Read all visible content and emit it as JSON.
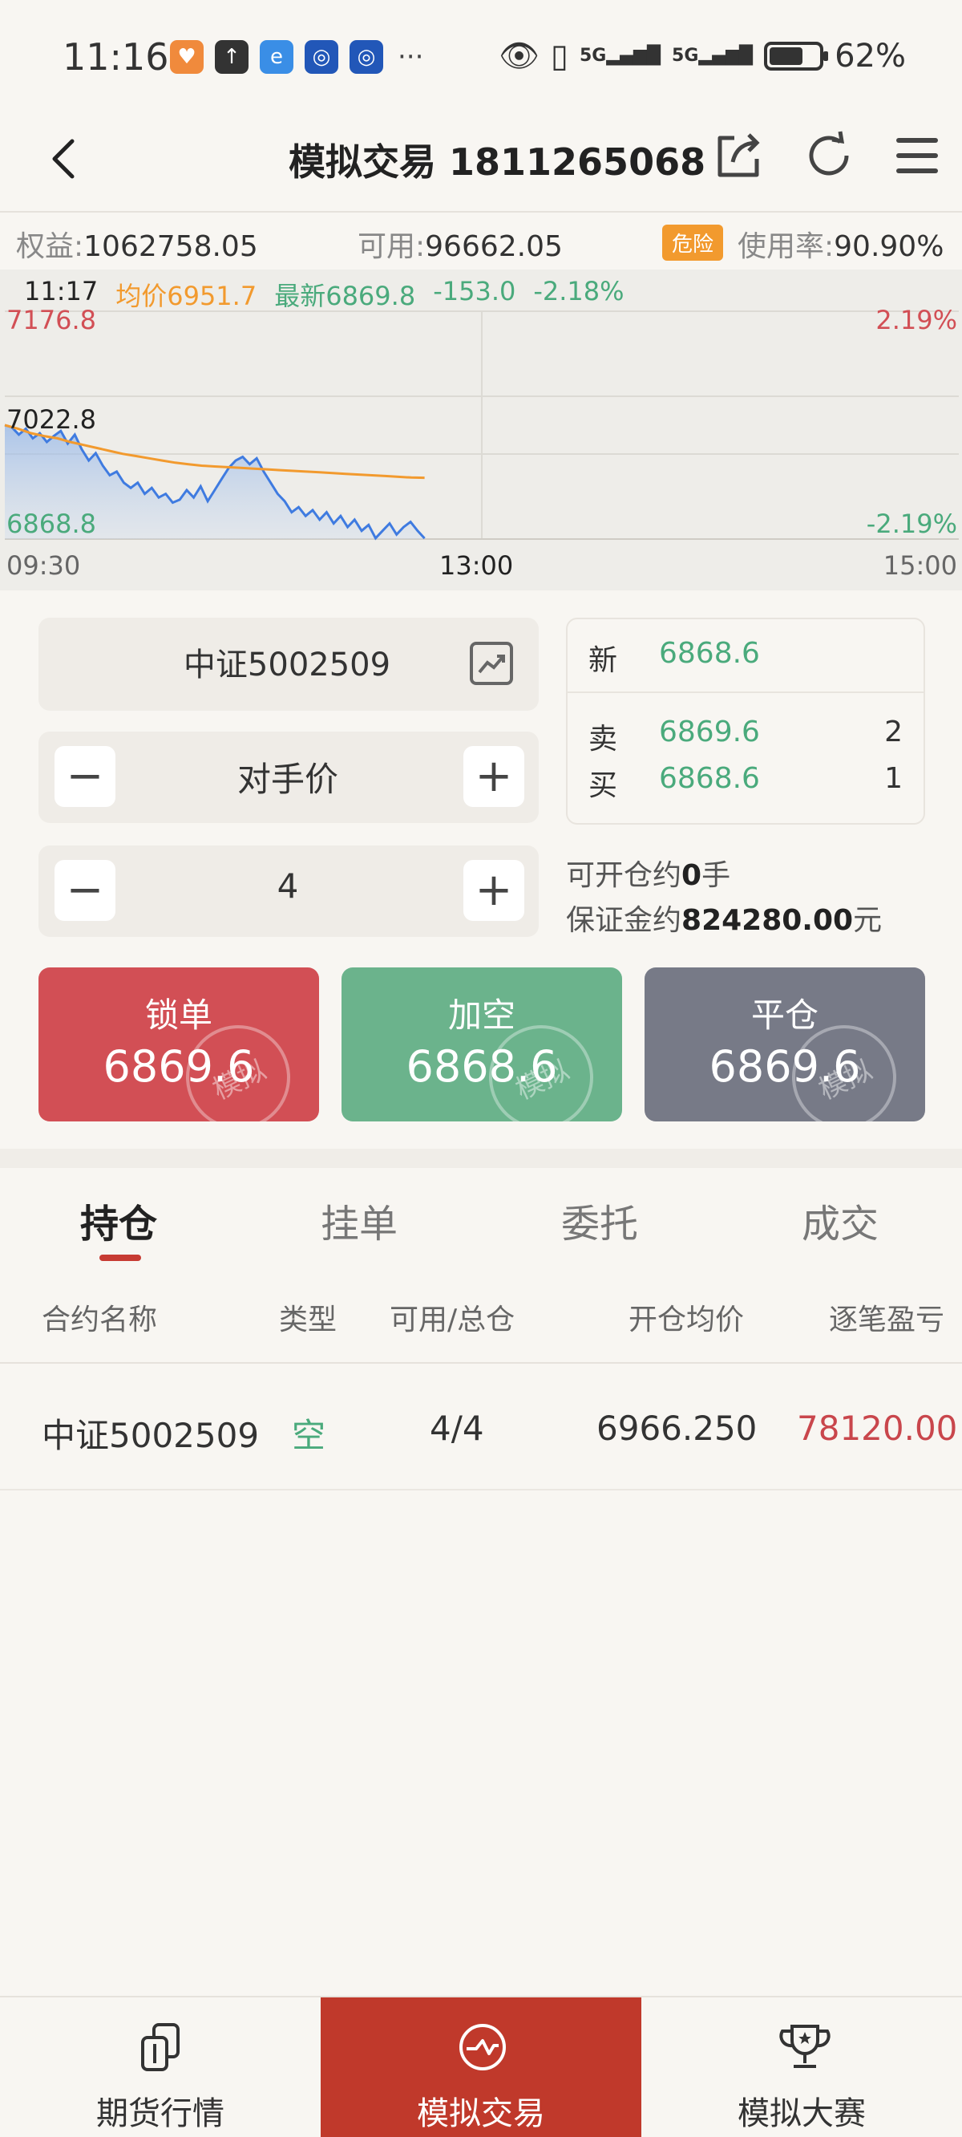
{
  "status_bar": {
    "time": "11:16",
    "battery": "62%",
    "network_1": "5G",
    "network_2": "5G"
  },
  "title_bar": {
    "title": "模拟交易 1811265068"
  },
  "account": {
    "equity_label": "权益:",
    "equity_value": "1062758.05",
    "available_label": "可用:",
    "available_value": "96662.05",
    "risk_badge": "危险",
    "usage_label": "使用率:",
    "usage_value": "90.90%"
  },
  "chart_data": {
    "type": "line",
    "header": {
      "time": "11:17",
      "avg": "均价6951.7",
      "latest": "最新6869.8",
      "change": "-153.0",
      "change_pct": "-2.18%"
    },
    "y_labels": {
      "top": "7176.8",
      "mid": "7022.8",
      "bottom": "6868.8"
    },
    "pct_labels": {
      "top": "2.19%",
      "bottom": "-2.19%"
    },
    "x_labels": [
      "09:30",
      "13:00",
      "15:00"
    ],
    "ylim": [
      6868.8,
      7176.8
    ],
    "series": [
      {
        "values": [
          7022.8,
          7020,
          7010,
          7018,
          7005,
          7012,
          7000,
          7008,
          7015,
          6998,
          7010,
          6990,
          6975,
          6985,
          6968,
          6955,
          6960,
          6945,
          6938,
          6945,
          6930,
          6938,
          6925,
          6930,
          6918,
          6922,
          6935,
          6925,
          6940,
          6920,
          6935,
          6950,
          6965,
          6975,
          6980,
          6970,
          6978,
          6960,
          6945,
          6930,
          6920,
          6905,
          6912,
          6900,
          6908,
          6895,
          6905,
          6890,
          6900,
          6885,
          6895,
          6880,
          6888,
          6870,
          6880,
          6890,
          6875,
          6885,
          6892,
          6880,
          6869.8
        ]
      },
      {
        "values": [
          7022.8,
          7018,
          7012,
          7008,
          7005,
          7000,
          6996,
          6992,
          6988,
          6984,
          6981,
          6978,
          6975,
          6972,
          6970,
          6968,
          6967,
          6966,
          6965,
          6964,
          6963,
          6962,
          6961,
          6960,
          6959,
          6958,
          6957,
          6956,
          6955,
          6954,
          6953,
          6952,
          6951.7
        ]
      }
    ]
  },
  "order": {
    "symbol": "中证5002509",
    "price_mode": "对手价",
    "quantity": "4",
    "minus": "−",
    "plus": "+"
  },
  "quote": {
    "new_label": "新",
    "new_price": "6868.6",
    "sell_label": "卖",
    "sell_price": "6869.6",
    "sell_qty": "2",
    "buy_label": "买",
    "buy_price": "6868.6",
    "buy_qty": "1"
  },
  "info": {
    "open_prefix": "可开仓约",
    "open_value": "0",
    "open_suffix": "手",
    "margin_prefix": "保证金约",
    "margin_value": "824280.00",
    "margin_suffix": "元"
  },
  "buttons": [
    {
      "label": "锁单",
      "price": "6869.6",
      "color": "#d24f55"
    },
    {
      "label": "加空",
      "price": "6868.6",
      "color": "#6bb38c"
    },
    {
      "label": "平仓",
      "price": "6869.6",
      "color": "#777a87"
    }
  ],
  "stamp_text": "模拟",
  "tabs": [
    "持仓",
    "挂单",
    "委托",
    "成交"
  ],
  "table": {
    "headers": [
      "合约名称",
      "类型",
      "可用/总仓",
      "开仓均价",
      "逐笔盈亏"
    ],
    "rows": [
      {
        "name": "中证5002509",
        "type": "空",
        "qty": "4/4",
        "avg_price": "6966.250",
        "pnl": "78120.00"
      }
    ]
  },
  "nav": [
    "期货行情",
    "模拟交易",
    "模拟大赛"
  ]
}
